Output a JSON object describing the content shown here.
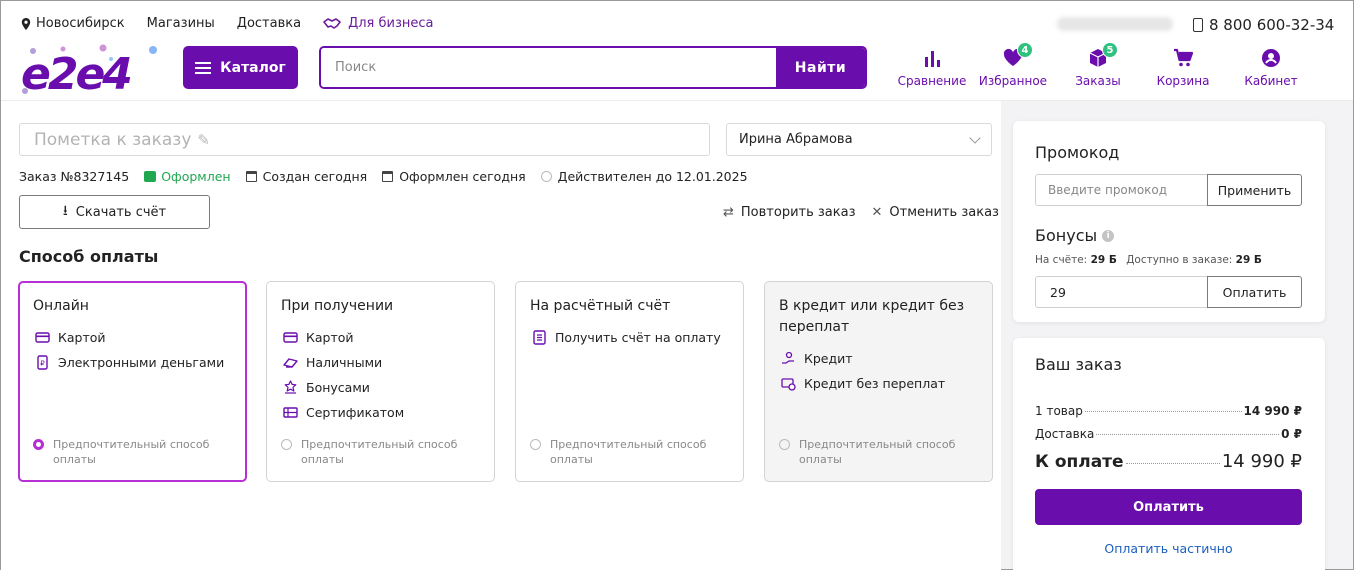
{
  "header": {
    "city": "Новосибирск",
    "links": [
      "Магазины",
      "Доставка"
    ],
    "business_link": "Для бизнеса",
    "phone": "8 800 600-32-34",
    "catalog_label": "Каталог",
    "search": {
      "placeholder": "Поиск",
      "button": "Найти"
    },
    "nav": [
      {
        "label": "Сравнение",
        "icon": "bar-chart-icon"
      },
      {
        "label": "Избранное",
        "icon": "heart-icon",
        "badge": "4"
      },
      {
        "label": "Заказы",
        "icon": "box-icon",
        "badge": "5"
      },
      {
        "label": "Корзина",
        "icon": "cart-icon"
      },
      {
        "label": "Кабинет",
        "icon": "user-icon"
      }
    ]
  },
  "order": {
    "note_placeholder": "Пометка к заказу",
    "manager": "Ирина Абрамова",
    "number": "Заказ №8327145",
    "status": "Оформлен",
    "created": "Создан сегодня",
    "placed": "Оформлен сегодня",
    "valid_until": "Действителен до 12.01.2025",
    "download_label": "Скачать счёт",
    "repeat_label": "Повторить заказ",
    "cancel_label": "Отменить заказ"
  },
  "payment": {
    "title": "Способ оплаты",
    "preferred_label": "Предпочтительный способ оплаты",
    "methods": [
      {
        "title": "Онлайн",
        "selected": true,
        "options": [
          {
            "label": "Картой",
            "icon": "card-icon"
          },
          {
            "label": "Электронными деньгами",
            "icon": "e-wallet-icon"
          }
        ]
      },
      {
        "title": "При получении",
        "selected": false,
        "options": [
          {
            "label": "Картой",
            "icon": "card-icon"
          },
          {
            "label": "Наличными",
            "icon": "cash-icon"
          },
          {
            "label": "Бонусами",
            "icon": "bonus-icon"
          },
          {
            "label": "Сертификатом",
            "icon": "certificate-icon"
          }
        ]
      },
      {
        "title": "На расчётный счёт",
        "selected": false,
        "options": [
          {
            "label": "Получить счёт на оплату",
            "icon": "invoice-icon"
          }
        ]
      },
      {
        "title": "В кредит или кредит без переплат",
        "selected": false,
        "options": [
          {
            "label": "Кредит",
            "icon": "credit-icon"
          },
          {
            "label": "Кредит без переплат",
            "icon": "installment-icon"
          }
        ]
      }
    ]
  },
  "promo": {
    "title": "Промокод",
    "placeholder": "Введите промокод",
    "apply_label": "Применить"
  },
  "bonus": {
    "title": "Бонусы",
    "on_account_label": "На счёте:",
    "on_account_value": "29 Б",
    "available_label": "Доступно в заказе:",
    "available_value": "29 Б",
    "input_value": "29",
    "pay_label": "Оплатить"
  },
  "summary": {
    "title": "Ваш заказ",
    "items_label": "1 товар",
    "items_value": "14 990 ₽",
    "delivery_label": "Доставка",
    "delivery_value": "0 ₽",
    "total_label": "К оплате",
    "total_value": "14 990 ₽",
    "pay_button": "Оплатить",
    "partial_link": "Оплатить частично"
  },
  "colors": {
    "brand": "#6a0dad",
    "accent": "#b52fd4",
    "success": "#1fa84f",
    "badge": "#2ec27e",
    "link": "#1a5fbf"
  }
}
